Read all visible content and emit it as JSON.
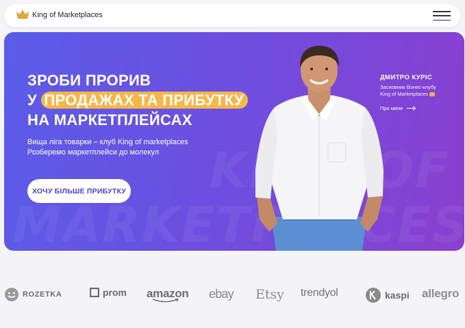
{
  "header": {
    "logo_text": "King of Marketplaces"
  },
  "hero": {
    "headline_line1": "ЗРОБИ ПРОРИВ",
    "headline_prefix": "У",
    "headline_highlight": "ПРОДАЖАХ ТА ПРИБУТКУ",
    "headline_line3": "НА МАРКЕТПЛЕЙСАХ",
    "subtitle_line1": "Вища ліга товарки – клуб King of marketplaces",
    "subtitle_line2": "Розберемо маркетплейси до молекул",
    "cta_label": "ХОЧУ БІЛЬШЕ ПРИБУТКУ",
    "watermark_1": "MARKETPLACES",
    "watermark_2": "KING OF",
    "founder": {
      "name": "ДМИТРО КУРІС",
      "role_line1": "Засновник бізнес-клубу",
      "role_line2": "King of Marketplaces",
      "about_link": "Про мене"
    },
    "colors": {
      "gradient_start": "#5a5ce8",
      "gradient_end": "#8a3fcf",
      "highlight": "#f6b64a"
    }
  },
  "marketplaces": [
    {
      "name": "ROZETKA"
    },
    {
      "name": "prom"
    },
    {
      "name": "amazon"
    },
    {
      "name": "ebay"
    },
    {
      "name": "Etsy"
    },
    {
      "name": "trendyol"
    },
    {
      "name": "kaspi"
    },
    {
      "name": "allegro"
    }
  ]
}
